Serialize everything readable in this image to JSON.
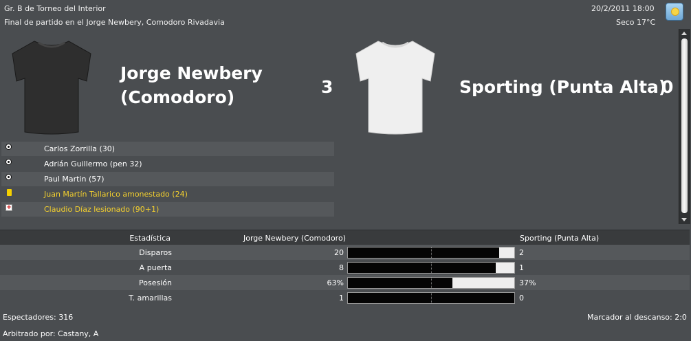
{
  "header": {
    "competition": "Gr. B de Torneo del Interior",
    "subtitle": "Final de partido en el Jorge Newbery, Comodoro Rivadavia",
    "datetime": "20/2/2011 18:00",
    "weather": "Seco 17°C",
    "weather_icon": "sun-weather-icon"
  },
  "home": {
    "name": "Jorge Newbery (Comodoro)",
    "name_line1": "Jorge Newbery",
    "name_line2": "(Comodoro)",
    "score": "3",
    "shirt_color": "#2e2e2e"
  },
  "away": {
    "name": "Sporting (Punta Alta)",
    "score": "0",
    "shirt_color": "#efefef"
  },
  "events": [
    {
      "icon": "goal-ball-icon",
      "text": "Carlos Zorrilla (30)"
    },
    {
      "icon": "goal-ball-icon",
      "text": "Adrián Guillermo (pen 32)"
    },
    {
      "icon": "goal-ball-icon",
      "text": "Paul Martin (57)"
    },
    {
      "icon": "yellow-card-icon",
      "text": "Juan Martín Tallarico amonestado (24)"
    },
    {
      "icon": "injury-icon",
      "text": "Claudio Díaz lesionado (90+1)"
    }
  ],
  "stats": {
    "col_label": "Estadística",
    "col_home": "Jorge Newbery (Comodoro)",
    "col_away": "Sporting (Punta Alta)",
    "rows": [
      {
        "label": "Disparos",
        "home": "20",
        "away": "2",
        "home_share": 0.909
      },
      {
        "label": "A puerta",
        "home": "8",
        "away": "1",
        "home_share": 0.889
      },
      {
        "label": "Posesión",
        "home": "63%",
        "away": "37%",
        "home_share": 0.63
      },
      {
        "label": "T. amarillas",
        "home": "1",
        "away": "0",
        "home_share": 1.0
      }
    ]
  },
  "footer": {
    "spectators": "Espectadores: 316",
    "referee": "Arbitrado por: Castany, A",
    "halftime": "Marcador al descanso: 2:0"
  }
}
